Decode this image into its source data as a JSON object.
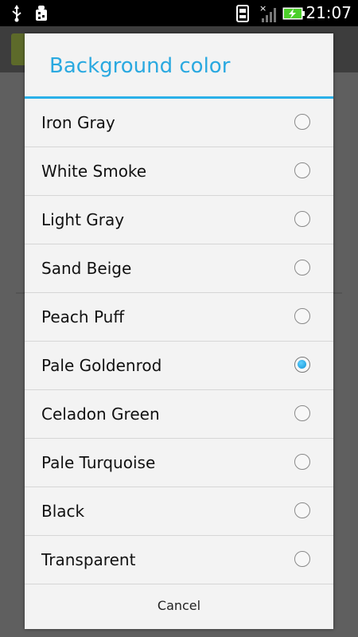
{
  "status_bar": {
    "time": "21:07",
    "icons": [
      "usb-icon",
      "android-debug-icon",
      "sd-card-icon",
      "no-signal-icon",
      "battery-charging-icon"
    ]
  },
  "dialog": {
    "title": "Background color",
    "options": [
      {
        "label": "Iron Gray",
        "selected": false
      },
      {
        "label": "White Smoke",
        "selected": false
      },
      {
        "label": "Light Gray",
        "selected": false
      },
      {
        "label": "Sand Beige",
        "selected": false
      },
      {
        "label": "Peach Puff",
        "selected": false
      },
      {
        "label": "Pale Goldenrod",
        "selected": true
      },
      {
        "label": "Celadon Green",
        "selected": false
      },
      {
        "label": "Pale Turquoise",
        "selected": false
      },
      {
        "label": "Black",
        "selected": false
      },
      {
        "label": "Transparent",
        "selected": false
      }
    ],
    "cancel_label": "Cancel"
  },
  "colors": {
    "accent": "#2aa9e0",
    "dialog_bg": "#f3f3f3",
    "status_bar_bg": "#000000",
    "battery_green": "#4ccf2a"
  }
}
